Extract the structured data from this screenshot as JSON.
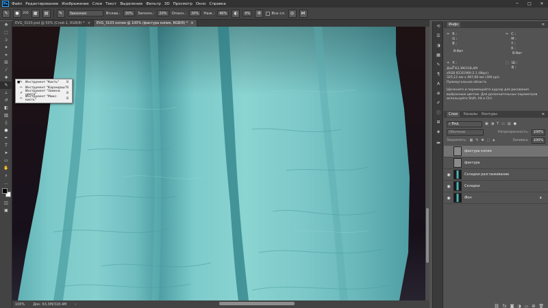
{
  "menu": [
    "Файл",
    "Редактирование",
    "Изображение",
    "Слои",
    "Текст",
    "Выделение",
    "Фильтр",
    "3D",
    "Просмотр",
    "Окно",
    "Справка"
  ],
  "app_logo": "Ps",
  "options": {
    "brush_size": "200",
    "mode_value": "Заказная",
    "opacity_label": "Вплав.:",
    "opacity_value": "20%",
    "flow_label": "Заполн.:",
    "flow_value": "20%",
    "smooth_label": "Опасн.:",
    "smooth_value": "20%",
    "wet_label": "Наж.:",
    "wet_value": "40%",
    "angle_value": "0%",
    "sample_all_label": "Все сл."
  },
  "tabs": [
    {
      "label": "EVG_3103.psd @ 50% (Слой 2, RGB/8) *"
    },
    {
      "label": "EVG_3103 копия @ 100% (фактура копия, RGB/8) *"
    }
  ],
  "flyout": [
    {
      "label": "Инструмент \"Кисть\"",
      "key": "B",
      "active": true
    },
    {
      "label": "Инструмент \"Карандаш\"",
      "key": "B",
      "active": false
    },
    {
      "label": "Инструмент \"Замена цвета\"",
      "key": "B",
      "active": false
    },
    {
      "label": "Инструмент \"Микс-кисть\"",
      "key": "B",
      "active": false
    }
  ],
  "status": {
    "zoom": "100%",
    "doc": "Док: 63,3M/318,4M"
  },
  "info_panel": {
    "tab": "Инфо",
    "r": "R :",
    "g": "G :",
    "b": "B :",
    "bits1": "8-бит",
    "c": "C :",
    "m": "M :",
    "y": "Y :",
    "k": "K :",
    "bits2": "8-бит",
    "x": "X :",
    "yy": "Y :",
    "w": "Ш :",
    "h": "В :",
    "doc": "Док: 63,3M/318,4M",
    "profile": "sRGB IEC61966-2.1 (8bpc)",
    "size": "325,12 мм x 487,68 мм (300 ppi)",
    "selection": "Прямоугольная область",
    "hint": "Щелкните и перемещайте курсор для рисования выбранным цветом. Для дополнительных параметров используйте Shift, Alt и Ctrl."
  },
  "layers_panel": {
    "tabs": [
      "Слои",
      "Каналы",
      "Контуры"
    ],
    "filter": "Вид",
    "blend": "Обычные",
    "opacity_label": "Непрозрачность:",
    "opacity_value": "100%",
    "lock_label": "Закрепить:",
    "fill_label": "Заливка:",
    "fill_value": "100%",
    "layers": [
      {
        "name": "фактура копия",
        "visible": false,
        "selected": true,
        "locked": false
      },
      {
        "name": "фактура",
        "visible": false,
        "selected": false,
        "locked": false
      },
      {
        "name": "Складки разглаживание",
        "visible": true,
        "selected": false,
        "locked": false
      },
      {
        "name": "Складки",
        "visible": true,
        "selected": false,
        "locked": false
      },
      {
        "name": "Фон",
        "visible": true,
        "selected": false,
        "locked": true
      }
    ]
  }
}
